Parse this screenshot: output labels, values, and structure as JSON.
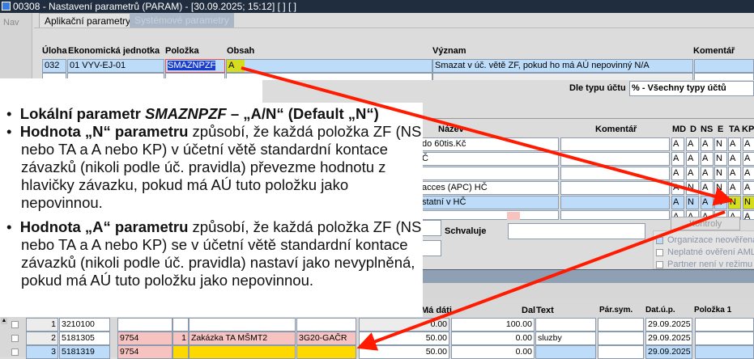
{
  "window": {
    "title": "00308 - Nastavení parametrů (PARAM) - [30.09.2025; 15:12]  [ ]  [ ]"
  },
  "nav": {
    "label": "Nav"
  },
  "tabs": [
    {
      "label": "Aplikační parametry",
      "active": true
    },
    {
      "label": "Systémové parametry",
      "active": false
    }
  ],
  "params": {
    "headers": {
      "uloha": "Úloha",
      "ej": "Ekonomická jednotka",
      "polozka": "Položka",
      "obsah": "Obsah",
      "vyznam": "Význam",
      "komentar": "Komentář"
    },
    "row": {
      "uloha": "032",
      "ej": "01 VYV-EJ-01",
      "polozka": "SMAZNPZF",
      "obsah": "A",
      "vyznam": "Smazat v úč. větě ZF, pokud ho má AÚ nepovinný N/A",
      "komentar": ""
    }
  },
  "filter": {
    "label": "Dle typu účtu",
    "value": "% - Všechny typy účtů"
  },
  "accounts": {
    "headers": {
      "nazev": "Název",
      "komentar": "Komentář",
      "md": "MD",
      "d": "D",
      "ns": "NS",
      "e": "E",
      "ta": "TA",
      "kp": "KP"
    },
    "rows": [
      {
        "nazev": "do 60tis.Kč",
        "flags": [
          "A",
          "A",
          "A",
          "N",
          "A",
          "A"
        ]
      },
      {
        "nazev": "Č",
        "flags": [
          "A",
          "A",
          "A",
          "N",
          "A",
          "A"
        ]
      },
      {
        "nazev": "",
        "flags": [
          "A",
          "A",
          "A",
          "N",
          "A",
          "A"
        ]
      },
      {
        "nazev": "acces (APC) HČ",
        "flags": [
          "A",
          "N",
          "A",
          "N",
          "A",
          "A"
        ]
      },
      {
        "nazev": "statní v HČ",
        "flags": [
          "A",
          "N",
          "A",
          "N",
          "N",
          "N"
        ],
        "selected": true
      },
      {
        "nazev": "",
        "flags": [
          "A",
          "A",
          "A",
          "",
          "A",
          "A"
        ]
      }
    ]
  },
  "form": {
    "schvaluje_label": "Schvaluje",
    "schvaluje_value": "",
    "kontroly_tab": "Kontroly",
    "checks": [
      "Organizace neověřena v",
      "Neplatné ověření AML",
      "Partner není v režimu NP"
    ]
  },
  "callout": {
    "b1_bold": "Lokální parametr ",
    "b1_italic": "SMAZNPZF",
    "b1_rest": " – „A/N“ (Default „N“)",
    "b2_bold": "Hodnota „N“ parametru",
    "b2_rest": " způsobí, že každá položka ZF (NS nebo TA a A nebo KP) v účetní větě standardní kontace závazků (nikoli podle úč. pravidla) převezme hodnotu z hlavičky závazku, pokud má AÚ tuto položku jako nepovinnou.",
    "b3_bold": "Hodnota „A“ parametru",
    "b3_rest": " způsobí, že každá položka ZF (NS nebo TA a A nebo KP) se v účetní větě standardní kontace závazků (nikoli podle úč. pravidla) nastaví jako nevyplněná, pokud má AÚ tuto položku jako nepovinnou."
  },
  "lines": {
    "headers": {
      "madati": "Má dáti",
      "dal": "Dal",
      "text": "Text",
      "parsym": "Pár.sym.",
      "datup": "Dat.ú.p.",
      "polozka1": "Položka 1"
    },
    "rows": [
      {
        "n": "1",
        "ucet": "3210100",
        "c3": "",
        "c4": "",
        "c5": "",
        "c6": "",
        "madati": "0.00",
        "dal": "100.00",
        "text": "",
        "parsym": "",
        "datup": "29.09.2025",
        "pol": ""
      },
      {
        "n": "2",
        "ucet": "5181305",
        "c3": "9754",
        "c4": "1",
        "c5": "Zakázka TA MŠMT2",
        "c6": "3G20-GAČR",
        "madati": "50.00",
        "dal": "0.00",
        "text": "sluzby",
        "parsym": "",
        "datup": "29.09.2025",
        "pol": ""
      },
      {
        "n": "3",
        "ucet": "5181319",
        "c3": "9754",
        "c4": "",
        "c5": "",
        "c6": "",
        "madati": "50.00",
        "dal": "0.00",
        "text": "",
        "parsym": "",
        "datup": "29.09.2025",
        "pol": ""
      }
    ]
  },
  "colors": {
    "arrow": "#ff1a00",
    "highlight": "#ffd800",
    "selection": "#bcdcfa"
  }
}
